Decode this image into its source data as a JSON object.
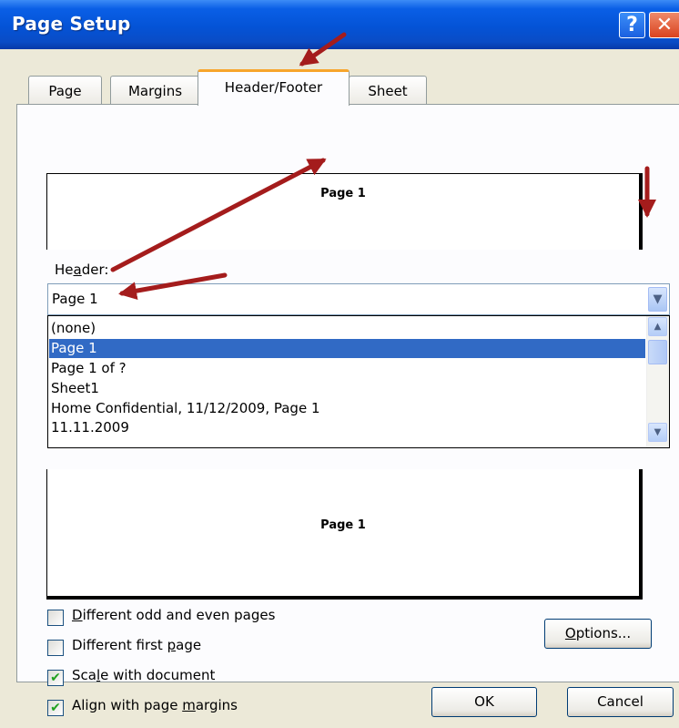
{
  "window": {
    "title": "Page Setup",
    "help_label": "?",
    "close_label": "✕"
  },
  "tabs": [
    {
      "label": "Page",
      "active": false
    },
    {
      "label": "Margins",
      "active": false
    },
    {
      "label": "Header/Footer",
      "active": true
    },
    {
      "label": "Sheet",
      "active": false
    }
  ],
  "header_preview": {
    "text": "Page 1"
  },
  "header": {
    "label_pre": "He",
    "label_key": "a",
    "label_post": "der:",
    "value": "Page 1"
  },
  "dropdown": {
    "options": [
      "(none)",
      "Page 1",
      "Page 1 of ?",
      "Sheet1",
      "Home Confidential, 11/12/2009, Page 1",
      "11.11.2009"
    ],
    "selected_index": 1
  },
  "footer_preview": {
    "text": "Page 1"
  },
  "checkboxes": [
    {
      "pre": "",
      "key": "D",
      "post": "ifferent odd and even pages",
      "checked": false
    },
    {
      "pre": "Different first ",
      "key": "p",
      "post": "age",
      "checked": false
    },
    {
      "pre": "Sca",
      "key": "l",
      "post": "e with document",
      "checked": true
    },
    {
      "pre": "Align with page ",
      "key": "m",
      "post": "argins",
      "checked": true
    }
  ],
  "buttons": {
    "options_key": "O",
    "options_rest": "ptions...",
    "ok": "OK",
    "cancel": "Cancel"
  },
  "colors": {
    "annotation_arrow": "#a41c1c",
    "selection": "#316ac5",
    "titlebar": "#0453d6"
  }
}
